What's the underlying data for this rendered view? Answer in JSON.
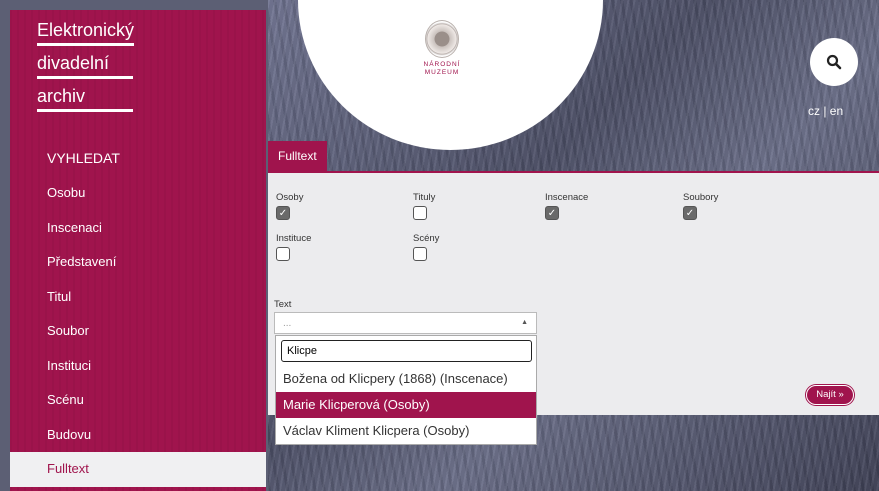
{
  "site": {
    "title_lines": [
      "Elektronický",
      "divadelní",
      "archiv"
    ]
  },
  "museum": {
    "name_line1": "NÁRODNÍ",
    "name_line2": "MUZEUM"
  },
  "lang": {
    "label": "cz | en"
  },
  "nav": {
    "heading": "VYHLEDAT",
    "items": [
      "Osobu",
      "Inscenaci",
      "Představení",
      "Titul",
      "Soubor",
      "Instituci",
      "Scénu",
      "Budovu",
      "Fulltext"
    ]
  },
  "tab": {
    "label": "Fulltext"
  },
  "filters": [
    {
      "label": "Osoby",
      "checked": true
    },
    {
      "label": "Tituly",
      "checked": false
    },
    {
      "label": "Inscenace",
      "checked": true
    },
    {
      "label": "Soubory",
      "checked": true
    },
    {
      "label": "Instituce",
      "checked": false
    },
    {
      "label": "Scény",
      "checked": false
    }
  ],
  "text_field": {
    "label": "Text",
    "placeholder": "..."
  },
  "dropdown": {
    "search_value": "Klicpe",
    "options": [
      "Božena od Klicpery (1868) (Inscenace)",
      "Marie Klicperová (Osoby)",
      "Václav Kliment Klicpera (Osoby)"
    ],
    "selected_index": 1
  },
  "find_button": {
    "label": "Najít »"
  },
  "colors": {
    "brand": "#a0144d",
    "panel": "#ececee"
  }
}
